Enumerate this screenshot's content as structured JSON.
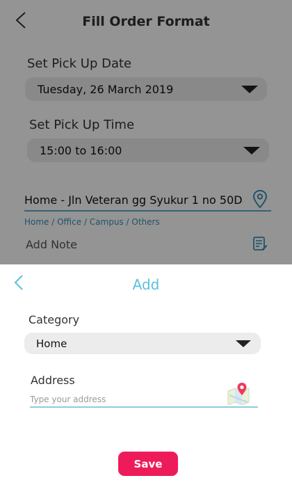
{
  "background_page": {
    "title": "Fill Order Format",
    "pickup_date": {
      "label": "Set Pick Up Date",
      "value": "Tuesday, 26 March 2019"
    },
    "pickup_time": {
      "label": "Set Pick Up Time",
      "value": "15:00 to 16:00"
    },
    "address": "Home  - Jln Veteran gg Syukur 1 no 50D",
    "address_categories": "Home / Office / Campus / Others",
    "add_note": "Add Note"
  },
  "sheet": {
    "title": "Add",
    "category": {
      "label": "Category",
      "value": "Home"
    },
    "address": {
      "label": "Address",
      "placeholder": "Type your address",
      "value": ""
    },
    "save_label": "Save"
  },
  "icons": {
    "back": "chevron-left-icon",
    "dropdown": "caret-down-icon",
    "location": "location-pin-icon",
    "note": "edit-note-icon",
    "map": "map-pin-icon"
  },
  "colors": {
    "accent_blue": "#5bc0de",
    "link_blue": "#3a8fb7",
    "save_button": "#ee1b5a",
    "field_background": "#ececec"
  }
}
